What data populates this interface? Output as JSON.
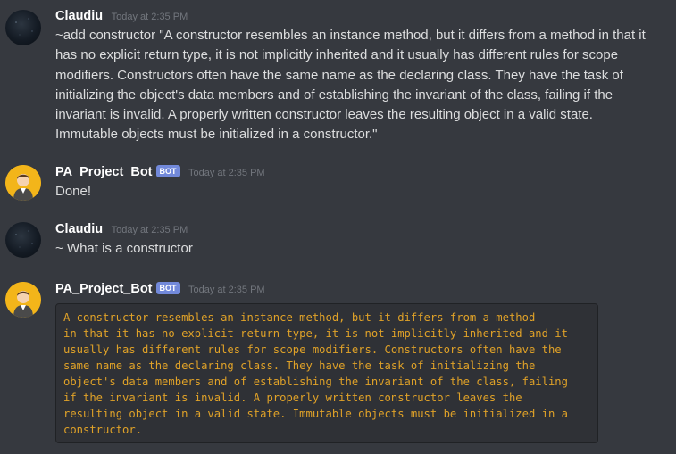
{
  "messages": [
    {
      "author": "Claudiu",
      "timestamp": "Today at 2:35 PM",
      "text": "~add constructor \"A constructor resembles an instance method, but it differs from a method in that it has no explicit return type, it is not implicitly inherited and it usually has different rules for scope modifiers. Constructors often have the same name as the declaring class. They have the task of initializing the object's data members and of establishing the invariant of the class, failing if the invariant is invalid. A properly written constructor leaves the resulting object in a valid state. Immutable objects must be initialized in a constructor.\""
    },
    {
      "author": "PA_Project_Bot",
      "bot_tag": "BOT",
      "timestamp": "Today at 2:35 PM",
      "text": "Done!"
    },
    {
      "author": "Claudiu",
      "timestamp": "Today at 2:35 PM",
      "text": "~ What is a constructor"
    },
    {
      "author": "PA_Project_Bot",
      "bot_tag": "BOT",
      "timestamp": "Today at 2:35 PM",
      "code": "A constructor resembles an instance method, but it differs from a method\nin that it has no explicit return type, it is not implicitly inherited and it\nusually has different rules for scope modifiers. Constructors often have the\nsame name as the declaring class. They have the task of initializing the\nobject's data members and of establishing the invariant of the class, failing\nif the invariant is invalid. A properly written constructor leaves the\nresulting object in a valid state. Immutable objects must be initialized in a\nconstructor."
    }
  ],
  "colors": {
    "background": "#36393f",
    "author": "#ffffff",
    "text": "#dcddde",
    "timestamp": "#72767d",
    "bot_tag": "#7289da",
    "code_text": "#e0a228",
    "code_bg": "#2f3136"
  },
  "icons": [
    "user-avatar-icon",
    "bot-avatar-icon"
  ]
}
